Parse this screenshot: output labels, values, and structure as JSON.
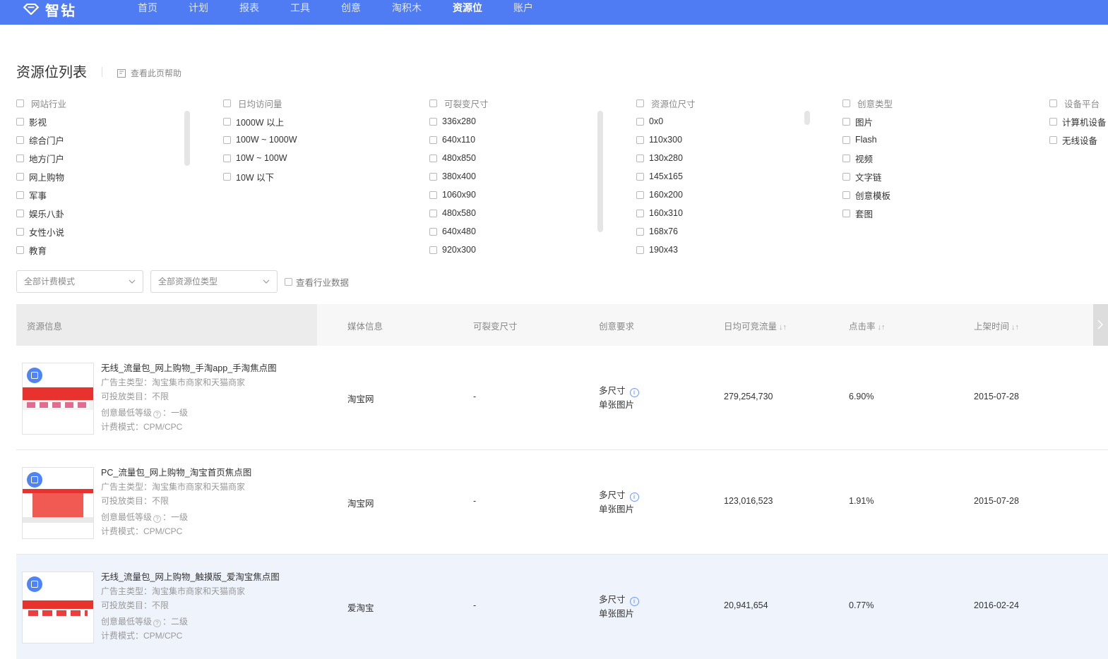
{
  "nav": {
    "logo_text": "智钻",
    "items": [
      {
        "label": "首页",
        "active": false
      },
      {
        "label": "计划",
        "active": false
      },
      {
        "label": "报表",
        "active": false
      },
      {
        "label": "工具",
        "active": false
      },
      {
        "label": "创意",
        "active": false
      },
      {
        "label": "淘积木",
        "active": false
      },
      {
        "label": "资源位",
        "active": true
      },
      {
        "label": "账户",
        "active": false
      }
    ]
  },
  "page": {
    "title": "资源位列表",
    "help_label": "查看此页帮助"
  },
  "filters": [
    {
      "header": "网站行业",
      "options": [
        "影视",
        "综合门户",
        "地方门户",
        "网上购物",
        "军事",
        "娱乐八卦",
        "女性小说",
        "教育"
      ]
    },
    {
      "header": "日均访问量",
      "options": [
        "1000W 以上",
        "100W ~ 1000W",
        "10W ~ 100W",
        "10W 以下"
      ]
    },
    {
      "header": "可裂变尺寸",
      "options": [
        "336x280",
        "640x110",
        "480x850",
        "380x400",
        "1060x90",
        "480x580",
        "640x480",
        "920x300"
      ]
    },
    {
      "header": "资源位尺寸",
      "options": [
        "0x0",
        "110x300",
        "130x280",
        "145x165",
        "160x200",
        "160x310",
        "168x76",
        "190x43"
      ]
    },
    {
      "header": "创意类型",
      "options": [
        "图片",
        "Flash",
        "视频",
        "文字链",
        "创意模板",
        "套图"
      ]
    },
    {
      "header": "设备平台",
      "options": [
        "计算机设备",
        "无线设备"
      ]
    }
  ],
  "toolbar": {
    "billing_placeholder": "全部计费模式",
    "type_placeholder": "全部资源位类型",
    "industry_data_label": "查看行业数据"
  },
  "table": {
    "columns": [
      "资源信息",
      "媒体信息",
      "可裂变尺寸",
      "创意要求",
      "日均可竞流量",
      "点击率",
      "上架时间"
    ],
    "sort_glyph": "↓↑",
    "rows": [
      {
        "name": "无线_流量包_网上购物_手淘app_手淘焦点图",
        "advertiser": "广告主类型：淘宝集市商家和天猫商家",
        "category": "可投放类目：不限",
        "level_label": "创意最低等级",
        "level_value": "：一级",
        "billing": "计费模式：CPM/CPC",
        "media": "淘宝网",
        "split_size": "-",
        "req_size": "多尺寸",
        "req_type": "单张图片",
        "traffic": "279,254,730",
        "ctr": "6.90%",
        "date": "2015-07-28"
      },
      {
        "name": "PC_流量包_网上购物_淘宝首页焦点图",
        "advertiser": "广告主类型：淘宝集市商家和天猫商家",
        "category": "可投放类目：不限",
        "level_label": "创意最低等级",
        "level_value": "：一级",
        "billing": "计费模式：CPM/CPC",
        "media": "淘宝网",
        "split_size": "-",
        "req_size": "多尺寸",
        "req_type": "单张图片",
        "traffic": "123,016,523",
        "ctr": "1.91%",
        "date": "2015-07-28"
      },
      {
        "name": "无线_流量包_网上购物_触摸版_爱淘宝焦点图",
        "advertiser": "广告主类型：淘宝集市商家和天猫商家",
        "category": "可投放类目：不限",
        "level_label": "创意最低等级",
        "level_value": "：二级",
        "billing": "计费模式：CPM/CPC",
        "media": "爱淘宝",
        "split_size": "-",
        "req_size": "多尺寸",
        "req_type": "单张图片",
        "traffic": "20,941,654",
        "ctr": "0.77%",
        "date": "2016-02-24"
      }
    ]
  },
  "colors": {
    "brand": "#4f7cf3",
    "badge": "#4f84f5",
    "highlight_row": "#eef3fc"
  }
}
